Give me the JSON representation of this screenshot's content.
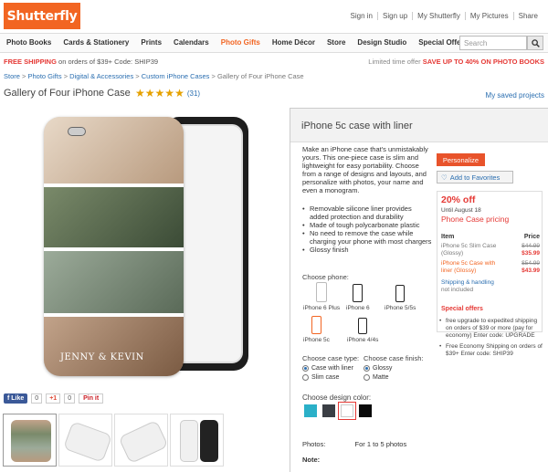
{
  "header": {
    "logo_text": "Shutterfly",
    "links": [
      "Sign in",
      "Sign up",
      "My Shutterfly",
      "My Pictures",
      "Share"
    ]
  },
  "nav": {
    "items": [
      "Photo Books",
      "Cards & Stationery",
      "Prints",
      "Calendars",
      "Photo Gifts",
      "Home Décor",
      "Store",
      "Design Studio",
      "Special Offers"
    ],
    "active": "Photo Gifts",
    "search_placeholder": "Search"
  },
  "promo": {
    "left_bold": "FREE SHIPPING",
    "left_rest": " on orders of $39+ Code: SHIP39",
    "right_lead": "Limited time offer ",
    "right_bold": "SAVE UP TO 40% ON PHOTO BOOKS"
  },
  "breadcrumb": {
    "items": [
      "Store",
      "Photo Gifts",
      "Digital & Accessories",
      "Custom iPhone Cases"
    ],
    "current": "Gallery of Four iPhone Case"
  },
  "product": {
    "title": "Gallery of Four iPhone Case",
    "rating": 5,
    "review_count": "(31)",
    "saved_link": "My saved projects",
    "case_text": "JENNY & KEVIN"
  },
  "social": {
    "like": "Like",
    "like_count": "0",
    "gplus": "+1",
    "gplus_count": "0",
    "pin": "Pin it"
  },
  "panel": {
    "title": "iPhone 5c case with liner",
    "description": "Make an iPhone case that's unmistakably yours. This one-piece case is slim and lightweight for easy portability. Choose from a range of designs and layouts, and personalize with photos, your name and even a monogram.",
    "features": [
      "Removable silicone liner provides added protection and durability",
      "Made of tough polycarbonate plastic",
      "No need to remove the case while charging your phone with most chargers",
      "Glossy finish"
    ],
    "choose_phone_label": "Choose phone:",
    "phones": [
      "iPhone 6 Plus",
      "iPhone 6",
      "iPhone 5/5s",
      "iPhone 5c",
      "iPhone 4/4s"
    ],
    "selected_phone": "iPhone 5c",
    "case_type_label": "Choose case type:",
    "case_types": [
      "Case with liner",
      "Slim case"
    ],
    "case_type_selected": "Case with liner",
    "finish_label": "Choose case finish:",
    "finishes": [
      "Glossy",
      "Matte"
    ],
    "finish_selected": "Glossy",
    "color_label": "Choose design color:",
    "colors": [
      "#2bb0c8",
      "#3b3f45",
      "#ffffff",
      "#0a0a0a"
    ],
    "color_selected_index": 2,
    "photos_label": "Photos:",
    "photos_value": "For 1 to 5 photos",
    "note_label": "Note:"
  },
  "buy": {
    "personalize": "Personalize",
    "favorites": "Add to Favorites",
    "discount": "20% off",
    "until": "Until August 18",
    "pricing_title": "Phone Case pricing",
    "col_item": "Item",
    "col_price": "Price",
    "rows": [
      {
        "name": "iPhone 5c Slim Case (Glossy)",
        "old": "$44.99",
        "new": "$35.99",
        "highlight": false
      },
      {
        "name": "iPhone 5c Case with liner (Glossy)",
        "old": "$54.99",
        "new": "$43.99",
        "highlight": true
      }
    ],
    "shipping_link": "Shipping & handling",
    "shipping_note": "not included",
    "offers_title": "Special offers",
    "offers": [
      "free upgrade to expedited shipping on orders of $39 or more (pay for economy) Enter code: UPGRADE",
      "Free Economy Shipping on orders of $39+ Enter code: SHIP39"
    ]
  },
  "colors": {
    "brand": "#f26522",
    "sale": "#e53935",
    "link": "#2a6eb0"
  }
}
